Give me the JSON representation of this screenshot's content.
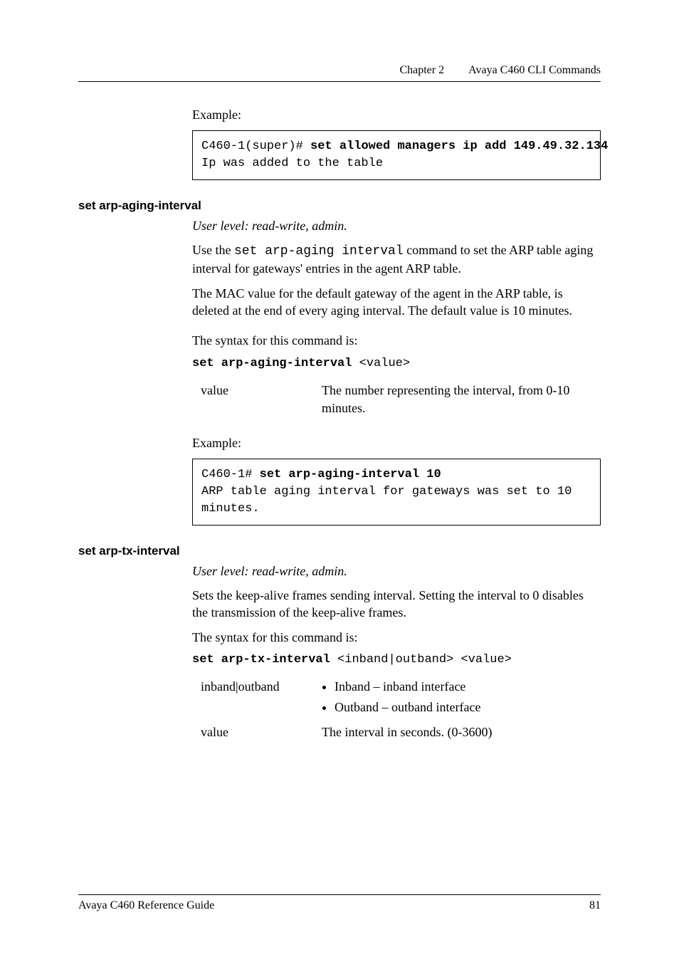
{
  "running_head": {
    "chapter": "Chapter 2",
    "title": "Avaya C460 CLI Commands"
  },
  "example_label": "Example:",
  "syntax_label": "The syntax for this command is:",
  "user_level": "User level: read-write, admin.",
  "ex1_line1_prefix": "C460-1(super)# ",
  "ex1_line1_cmd": "set allowed managers ip add 149.49.32.134",
  "ex1_line2": "Ip was added to the table",
  "s1": {
    "head": "set arp-aging-interval",
    "p1a": "Use the ",
    "p1b": "set arp-aging interval",
    "p1c": " command to set the ARP table aging interval for gateways' entries in the agent ARP table.",
    "p2": "The MAC value for the default gateway of the agent in the ARP table, is deleted at the end of every aging interval. The default value is 10 minutes.",
    "synt_cmd": "set arp-aging-interval",
    "synt_arg": " <value>",
    "param_name": "value",
    "param_desc": "The number representing the interval, from 0-10 minutes.",
    "ex_line1_prefix": "C460-1# ",
    "ex_line1_cmd": "set arp-aging-interval 10",
    "ex_line2": "ARP table aging interval for gateways was set to 10",
    "ex_line3": "minutes."
  },
  "s2": {
    "head": "set arp-tx-interval",
    "p1": "Sets the keep-alive frames sending interval. Setting the interval to 0 disables the transmission of the keep-alive frames.",
    "synt_cmd": "set arp-tx-interval",
    "synt_arg": " <inband|outband> <value>",
    "param1_name": "inband|outband",
    "param1_b1": "Inband – inband interface",
    "param1_b2": "Outband – outband interface",
    "param2_name": "value",
    "param2_desc": "The interval in seconds. (0-3600)"
  },
  "footer": {
    "left": "Avaya C460 Reference Guide",
    "right": "81"
  }
}
